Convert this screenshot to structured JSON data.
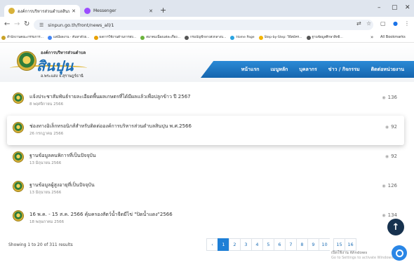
{
  "browser": {
    "tabs": [
      {
        "title": "องค์การบริหารส่วนตำบลสินปุน อ.เขา",
        "active": true
      },
      {
        "title": "Messenger",
        "active": false
      }
    ],
    "new_tab": "+",
    "window_controls": {
      "minimize": "–",
      "maximize": "▢",
      "close": "✕"
    },
    "url": "sinpun.go.th/front/news_all/1",
    "bookmarks": [
      "สำนักงานคณะกรรมการ...",
      "แต่มีผลงาน - ค้นหาด้วย...",
      "ผลการใช้งานด้านการส่ง...",
      "สมาคมเนื่องแต่ละเรื่อง...",
      "กรมบัญชีกลางส่งกลางบ...",
      "Home Page",
      "Step-by-Step: วิธีสมัคร...",
      "ฐานข้อมูลศึกษาสิทธิ..."
    ],
    "bookmarks_more": "»",
    "all_bookmarks": "All Bookmarks"
  },
  "site": {
    "org_name": "องค์การบริหารส่วนตำบล",
    "brand": "สินปุน",
    "district_province": "อ.พระแสง   จ.สุราษฎร์ธานี",
    "nav": [
      "หน้าแรก",
      "เมนูหลัก",
      "บุคลากร",
      "ข่าว / กิจกรรม",
      "ติดต่อหน่วยงาน"
    ]
  },
  "news": [
    {
      "title": "แจ้งประชาสัมพันธ์รายละเอียดพื้นผลเกษตรที่ได้มีผลแล้วเพื่อปลูกข้าว ปี 2567",
      "date": "8 พฤศจิกายน 2566",
      "views": "136"
    },
    {
      "title": "ช่องทางอิเล็กทรอนิกส์สำหรับติดต่อองค์การบริหารส่วนตำบลสินปุน พ.ศ.2566",
      "date": "26 กรกฎาคม 2566",
      "views": "92"
    },
    {
      "title": "ฐานข้อมูลคนพิการที่เป็นปัจจุบัน",
      "date": "13 มิถุนายน 2566",
      "views": "92"
    },
    {
      "title": "ฐานข้อมูลผู้สูงอายุที่เป็นปัจจุบัน",
      "date": "13 มิถุนายน 2566",
      "views": "126"
    },
    {
      "title": "16 พ.ค. - 15 ส.ค. 2566 คุ้มครองสัตว์น้ำจืดมีไข่ \"ปิดน้ำแดง\"2566",
      "date": "18 พฤษภาคม 2566",
      "views": "134"
    }
  ],
  "pagination": {
    "showing": "Showing 1 to 20 of 311 results",
    "prev": "‹",
    "pages": [
      "1",
      "2",
      "3",
      "4",
      "5",
      "6",
      "7",
      "8",
      "9",
      "10"
    ],
    "ellipsis": "",
    "tail": [
      "15",
      "16"
    ]
  },
  "activate_windows": {
    "line1": "เปิดใช้งาน Windows",
    "line2": "Go to Settings to activate Windows."
  }
}
